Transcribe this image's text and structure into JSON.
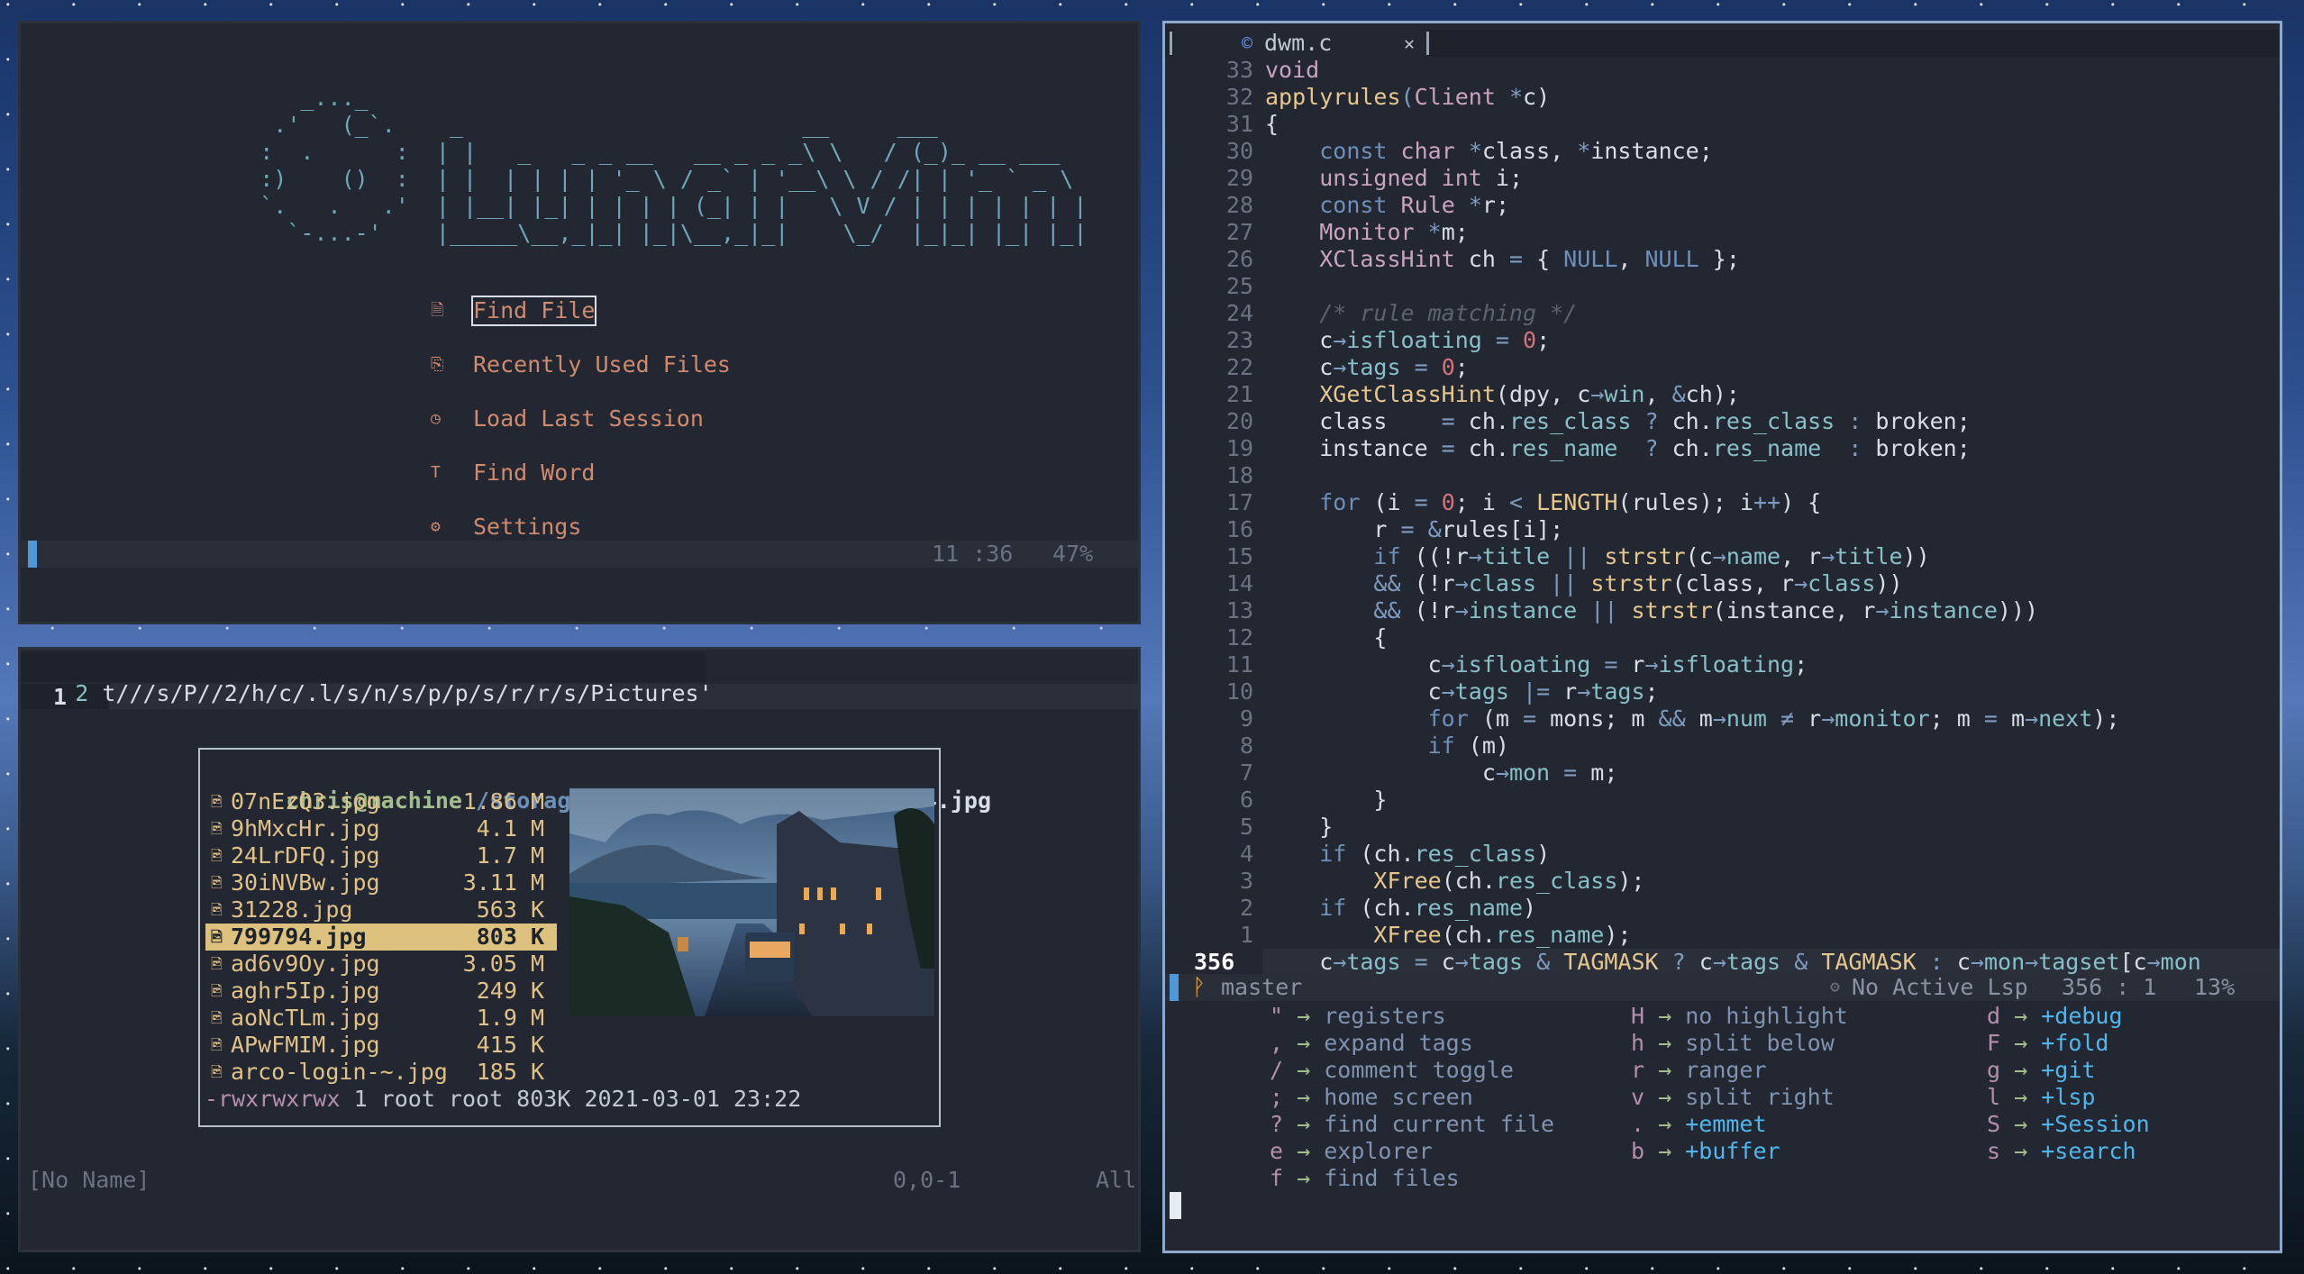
{
  "colors": {
    "accent": "#4f98d8",
    "menu": "#d08a6e",
    "selection": "#dcc27e"
  },
  "dashboard": {
    "ascii_logo": [
      "        _..._",
      "      .'   (_`.    _                         __     ___",
      "     :  .      :  | |   _   _ _ __   __ _ _ _\\ \\   / (_)_ __ ___",
      "     :)    ()  :  | |  | | | | '_ \\ / _` | '__\\ \\ / /| | '_ ` _ \\",
      "     `.   .   .'  | |__| |_| | | | | (_| | |   \\ V / | | | | | | |",
      "       `-...-'    |_____\\__,_|_| |_|\\__,_|_|    \\_/  |_|_| |_| |_|"
    ],
    "menu": [
      {
        "icon": "file-icon",
        "glyph": "🗎",
        "label": "Find File"
      },
      {
        "icon": "recent-files-icon",
        "glyph": "⎘",
        "label": "Recently Used Files"
      },
      {
        "icon": "session-icon",
        "glyph": "◷",
        "label": "Load Last Session"
      },
      {
        "icon": "text-icon",
        "glyph": "T",
        "label": "Find Word"
      },
      {
        "icon": "gear-icon",
        "glyph": "⚙",
        "label": "Settings"
      }
    ],
    "status": {
      "position": "11 :36",
      "percent": "47%"
    }
  },
  "ranger": {
    "tabline": {
      "num": "2",
      "path": "t///s/P//2/h/c/.l/s/n/s/p/p/s/r/r/s/Pictures'"
    },
    "line_number": "1",
    "header": {
      "user": "chris@machine",
      "dir": " /storag/Pictures/wallpapers/",
      "file": "799794.jpg"
    },
    "files": [
      {
        "name": "07nEzQ3.jpg",
        "size": "1.86 M"
      },
      {
        "name": "9hMxcHr.jpg",
        "size": "4.1 M"
      },
      {
        "name": "24LrDFQ.jpg",
        "size": "1.7 M"
      },
      {
        "name": "30iNVBw.jpg",
        "size": "3.11 M"
      },
      {
        "name": "31228.jpg",
        "size": "563 K"
      },
      {
        "name": "799794.jpg",
        "size": "803 K",
        "selected": true
      },
      {
        "name": "ad6v9Oy.jpg",
        "size": "3.05 M"
      },
      {
        "name": "aghr5Ip.jpg",
        "size": "249 K"
      },
      {
        "name": "aoNcTLm.jpg",
        "size": "1.9 M"
      },
      {
        "name": "APwFMIM.jpg",
        "size": "415 K"
      },
      {
        "name": "arco-login-~.jpg",
        "size": "185 K"
      }
    ],
    "perms": "-rwxrwxrwx",
    "file_info": " 1 root root 803K 2021-03-01 23:22",
    "status": {
      "name": "[No Name]",
      "position": "0,0-1",
      "scroll": "All"
    }
  },
  "editor": {
    "tab": {
      "label": "dwm.c",
      "close": "✕"
    },
    "lines": [
      {
        "num": "33",
        "tokens": [
          [
            "void",
            "t"
          ]
        ]
      },
      {
        "num": "32",
        "tokens": [
          [
            "applyrules",
            "f"
          ],
          [
            "(",
            "o"
          ],
          [
            "Client",
            "t"
          ],
          [
            " "
          ],
          [
            "*",
            "o"
          ],
          [
            "c)"
          ]
        ]
      },
      {
        "num": "31",
        "tokens": [
          [
            "{"
          ]
        ]
      },
      {
        "num": "30",
        "tokens": [
          [
            "    "
          ],
          [
            "const",
            "k"
          ],
          [
            " "
          ],
          [
            "char",
            "t"
          ],
          [
            " "
          ],
          [
            "*",
            "o"
          ],
          [
            "class, "
          ],
          [
            "*",
            "o"
          ],
          [
            "instance;"
          ]
        ]
      },
      {
        "num": "29",
        "tokens": [
          [
            "    "
          ],
          [
            "unsigned int",
            "t"
          ],
          [
            " i;"
          ]
        ]
      },
      {
        "num": "28",
        "tokens": [
          [
            "    "
          ],
          [
            "const",
            "k"
          ],
          [
            " "
          ],
          [
            "Rule",
            "t"
          ],
          [
            " "
          ],
          [
            "*",
            "o"
          ],
          [
            "r;"
          ]
        ]
      },
      {
        "num": "27",
        "tokens": [
          [
            "    "
          ],
          [
            "Monitor",
            "t"
          ],
          [
            " "
          ],
          [
            "*",
            "o"
          ],
          [
            "m;"
          ]
        ]
      },
      {
        "num": "26",
        "tokens": [
          [
            "    "
          ],
          [
            "XClassHint",
            "t"
          ],
          [
            " ch "
          ],
          [
            "=",
            "o"
          ],
          [
            " { "
          ],
          [
            "NULL",
            "k"
          ],
          [
            ", "
          ],
          [
            "NULL",
            "k"
          ],
          [
            " };"
          ]
        ]
      },
      {
        "num": "25",
        "tokens": []
      },
      {
        "num": "24",
        "tokens": [
          [
            "    "
          ],
          [
            "/* rule matching */",
            "c"
          ]
        ]
      },
      {
        "num": "23",
        "tokens": [
          [
            "    c"
          ],
          [
            "→",
            "o"
          ],
          [
            "isfloating",
            "p"
          ],
          [
            " "
          ],
          [
            "=",
            "o"
          ],
          [
            " "
          ],
          [
            "0",
            "n"
          ],
          [
            ";"
          ]
        ]
      },
      {
        "num": "22",
        "tokens": [
          [
            "    c"
          ],
          [
            "→",
            "o"
          ],
          [
            "tags",
            "p"
          ],
          [
            " "
          ],
          [
            "=",
            "o"
          ],
          [
            " "
          ],
          [
            "0",
            "n"
          ],
          [
            ";"
          ]
        ]
      },
      {
        "num": "21",
        "tokens": [
          [
            "    "
          ],
          [
            "XGetClassHint",
            "f"
          ],
          [
            "(dpy, c"
          ],
          [
            "→",
            "o"
          ],
          [
            "win",
            "p"
          ],
          [
            ", "
          ],
          [
            "&",
            "o"
          ],
          [
            "ch);"
          ]
        ]
      },
      {
        "num": "20",
        "tokens": [
          [
            "    class    "
          ],
          [
            "=",
            "o"
          ],
          [
            " ch."
          ],
          [
            "res_class",
            "p"
          ],
          [
            " "
          ],
          [
            "?",
            "o"
          ],
          [
            " ch."
          ],
          [
            "res_class",
            "p"
          ],
          [
            " "
          ],
          [
            ":",
            "o"
          ],
          [
            " broken;"
          ]
        ]
      },
      {
        "num": "19",
        "tokens": [
          [
            "    instance "
          ],
          [
            "=",
            "o"
          ],
          [
            " ch."
          ],
          [
            "res_name",
            "p"
          ],
          [
            "  "
          ],
          [
            "?",
            "o"
          ],
          [
            " ch."
          ],
          [
            "res_name",
            "p"
          ],
          [
            "  "
          ],
          [
            ":",
            "o"
          ],
          [
            " broken;"
          ]
        ]
      },
      {
        "num": "18",
        "tokens": []
      },
      {
        "num": "17",
        "tokens": [
          [
            "    "
          ],
          [
            "for",
            "k"
          ],
          [
            " (i "
          ],
          [
            "=",
            "o"
          ],
          [
            " "
          ],
          [
            "0",
            "n"
          ],
          [
            "; i "
          ],
          [
            "<",
            "o"
          ],
          [
            " "
          ],
          [
            "LENGTH",
            "f"
          ],
          [
            "(rules); i"
          ],
          [
            "++",
            "o"
          ],
          [
            ") {"
          ]
        ]
      },
      {
        "num": "16",
        "tokens": [
          [
            "        r "
          ],
          [
            "=",
            "o"
          ],
          [
            " "
          ],
          [
            "&",
            "o"
          ],
          [
            "rules[i];"
          ]
        ]
      },
      {
        "num": "15",
        "tokens": [
          [
            "        "
          ],
          [
            "if",
            "k"
          ],
          [
            " ((!r"
          ],
          [
            "→",
            "o"
          ],
          [
            "title",
            "p"
          ],
          [
            " "
          ],
          [
            "||",
            "o"
          ],
          [
            " "
          ],
          [
            "strstr",
            "f"
          ],
          [
            "(c"
          ],
          [
            "→",
            "o"
          ],
          [
            "name",
            "p"
          ],
          [
            ", r"
          ],
          [
            "→",
            "o"
          ],
          [
            "title",
            "p"
          ],
          [
            "))"
          ]
        ]
      },
      {
        "num": "14",
        "tokens": [
          [
            "        "
          ],
          [
            "&&",
            "o"
          ],
          [
            " (!r"
          ],
          [
            "→",
            "o"
          ],
          [
            "class",
            "p"
          ],
          [
            " "
          ],
          [
            "||",
            "o"
          ],
          [
            " "
          ],
          [
            "strstr",
            "f"
          ],
          [
            "(class, r"
          ],
          [
            "→",
            "o"
          ],
          [
            "class",
            "p"
          ],
          [
            "))"
          ]
        ]
      },
      {
        "num": "13",
        "tokens": [
          [
            "        "
          ],
          [
            "&&",
            "o"
          ],
          [
            " (!r"
          ],
          [
            "→",
            "o"
          ],
          [
            "instance",
            "p"
          ],
          [
            " "
          ],
          [
            "||",
            "o"
          ],
          [
            " "
          ],
          [
            "strstr",
            "f"
          ],
          [
            "(instance, r"
          ],
          [
            "→",
            "o"
          ],
          [
            "instance",
            "p"
          ],
          [
            ")))"
          ]
        ]
      },
      {
        "num": "12",
        "tokens": [
          [
            "        {"
          ]
        ]
      },
      {
        "num": "11",
        "tokens": [
          [
            "            c"
          ],
          [
            "→",
            "o"
          ],
          [
            "isfloating",
            "p"
          ],
          [
            " "
          ],
          [
            "=",
            "o"
          ],
          [
            " r"
          ],
          [
            "→",
            "o"
          ],
          [
            "isfloating",
            "p"
          ],
          [
            ";"
          ]
        ]
      },
      {
        "num": "10",
        "tokens": [
          [
            "            c"
          ],
          [
            "→",
            "o"
          ],
          [
            "tags",
            "p"
          ],
          [
            " "
          ],
          [
            "|=",
            "o"
          ],
          [
            " r"
          ],
          [
            "→",
            "o"
          ],
          [
            "tags",
            "p"
          ],
          [
            ";"
          ]
        ]
      },
      {
        "num": "9",
        "tokens": [
          [
            "            "
          ],
          [
            "for",
            "k"
          ],
          [
            " (m "
          ],
          [
            "=",
            "o"
          ],
          [
            " mons; m "
          ],
          [
            "&&",
            "o"
          ],
          [
            " m"
          ],
          [
            "→",
            "o"
          ],
          [
            "num",
            "p"
          ],
          [
            " "
          ],
          [
            "≠",
            "o"
          ],
          [
            " r"
          ],
          [
            "→",
            "o"
          ],
          [
            "monitor",
            "p"
          ],
          [
            "; m "
          ],
          [
            "=",
            "o"
          ],
          [
            " m"
          ],
          [
            "→",
            "o"
          ],
          [
            "next",
            "p"
          ],
          [
            ");"
          ]
        ]
      },
      {
        "num": "8",
        "tokens": [
          [
            "            "
          ],
          [
            "if",
            "k"
          ],
          [
            " (m)"
          ]
        ]
      },
      {
        "num": "7",
        "tokens": [
          [
            "                c"
          ],
          [
            "→",
            "o"
          ],
          [
            "mon",
            "p"
          ],
          [
            " "
          ],
          [
            "=",
            "o"
          ],
          [
            " m;"
          ]
        ]
      },
      {
        "num": "6",
        "tokens": [
          [
            "        }"
          ]
        ]
      },
      {
        "num": "5",
        "tokens": [
          [
            "    }"
          ]
        ]
      },
      {
        "num": "4",
        "tokens": [
          [
            "    "
          ],
          [
            "if",
            "k"
          ],
          [
            " (ch."
          ],
          [
            "res_class",
            "p"
          ],
          [
            ")"
          ]
        ]
      },
      {
        "num": "3",
        "tokens": [
          [
            "        "
          ],
          [
            "XFree",
            "f"
          ],
          [
            "(ch."
          ],
          [
            "res_class",
            "p"
          ],
          [
            ");"
          ]
        ]
      },
      {
        "num": "2",
        "tokens": [
          [
            "    "
          ],
          [
            "if",
            "k"
          ],
          [
            " (ch."
          ],
          [
            "res_name",
            "p"
          ],
          [
            ")"
          ]
        ]
      },
      {
        "num": "1",
        "tokens": [
          [
            "        "
          ],
          [
            "XFree",
            "f"
          ],
          [
            "(ch."
          ],
          [
            "res_name",
            "p"
          ],
          [
            ");"
          ]
        ]
      },
      {
        "num": "356",
        "current": true,
        "tokens": [
          [
            "    c"
          ],
          [
            "→",
            "o"
          ],
          [
            "tags",
            "p"
          ],
          [
            " "
          ],
          [
            "=",
            "o"
          ],
          [
            " c"
          ],
          [
            "→",
            "o"
          ],
          [
            "tags",
            "p"
          ],
          [
            " "
          ],
          [
            "&",
            "o"
          ],
          [
            " "
          ],
          [
            "TAGMASK",
            "f"
          ],
          [
            " "
          ],
          [
            "?",
            "o"
          ],
          [
            " c"
          ],
          [
            "→",
            "o"
          ],
          [
            "tags",
            "p"
          ],
          [
            " "
          ],
          [
            "&",
            "o"
          ],
          [
            " "
          ],
          [
            "TAGMASK",
            "f"
          ],
          [
            " "
          ],
          [
            ":",
            "o"
          ],
          [
            " c"
          ],
          [
            "→",
            "o"
          ],
          [
            "mon",
            "p"
          ],
          [
            "→",
            "o"
          ],
          [
            "tagset",
            "p"
          ],
          [
            "[c"
          ],
          [
            "→",
            "o"
          ],
          [
            "mon",
            "p"
          ]
        ]
      }
    ],
    "status": {
      "branch": "master",
      "lsp": "No Active Lsp",
      "position": "356 : 1",
      "percent": "13%"
    },
    "whichkey": [
      [
        {
          "key": "\"",
          "desc": "registers"
        },
        {
          "key": ",",
          "desc": "expand tags"
        },
        {
          "key": "/",
          "desc": "comment toggle"
        },
        {
          "key": ";",
          "desc": "home screen"
        },
        {
          "key": "?",
          "desc": "find current file"
        },
        {
          "key": "e",
          "desc": "explorer"
        },
        {
          "key": "f",
          "desc": "find files"
        }
      ],
      [
        {
          "key": "H",
          "desc": "no highlight"
        },
        {
          "key": "h",
          "desc": "split below"
        },
        {
          "key": "r",
          "desc": "ranger"
        },
        {
          "key": "v",
          "desc": "split right"
        },
        {
          "key": ".",
          "desc": "+emmet",
          "group": true
        },
        {
          "key": "b",
          "desc": "+buffer",
          "group": true
        }
      ],
      [
        {
          "key": "d",
          "desc": "+debug",
          "group": true
        },
        {
          "key": "F",
          "desc": "+fold",
          "group": true
        },
        {
          "key": "g",
          "desc": "+git",
          "group": true
        },
        {
          "key": "l",
          "desc": "+lsp",
          "group": true
        },
        {
          "key": "S",
          "desc": "+Session",
          "group": true
        },
        {
          "key": "s",
          "desc": "+search",
          "group": true
        }
      ]
    ],
    "arrow": "→"
  }
}
